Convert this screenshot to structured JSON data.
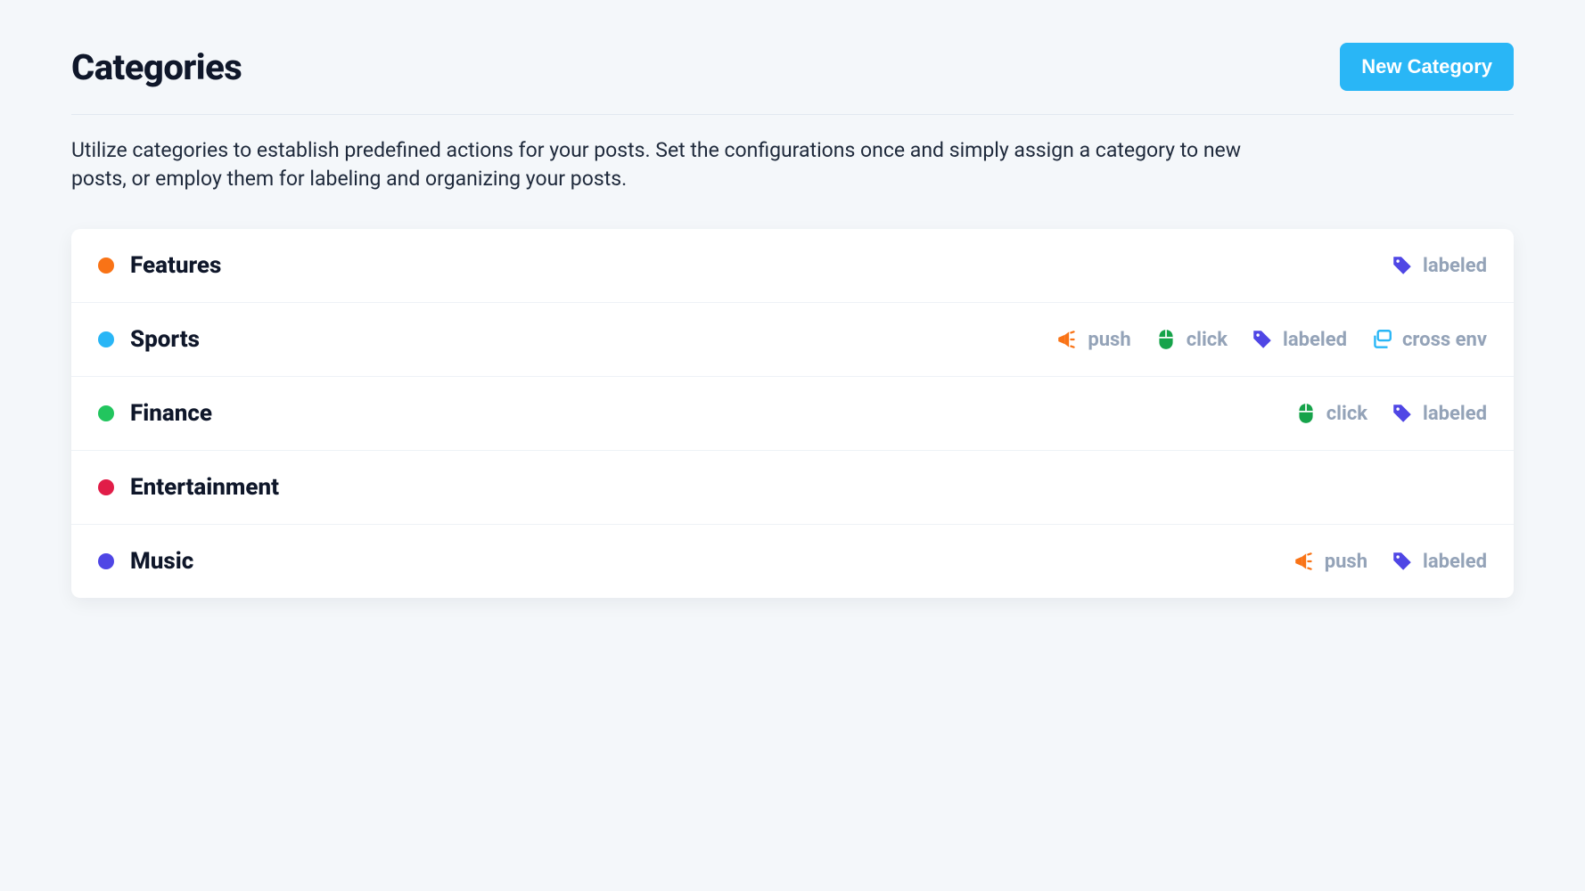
{
  "header": {
    "title": "Categories",
    "new_button": "New Category"
  },
  "description": "Utilize categories to establish predefined actions for your posts. Set the configurations once and simply assign a category to new posts, or employ them for labeling and organizing your posts.",
  "tag_types": {
    "push": {
      "label": "push",
      "icon": "bullhorn",
      "color": "#f97316"
    },
    "click": {
      "label": "click",
      "icon": "mouse",
      "color": "#16a34a"
    },
    "labeled": {
      "label": "labeled",
      "icon": "tag",
      "color": "#4f46e5"
    },
    "cross": {
      "label": "cross env",
      "icon": "layers",
      "color": "#29b6f6"
    }
  },
  "categories": [
    {
      "name": "Features",
      "color": "#f97316",
      "tags": [
        "labeled"
      ]
    },
    {
      "name": "Sports",
      "color": "#29b6f6",
      "tags": [
        "push",
        "click",
        "labeled",
        "cross"
      ]
    },
    {
      "name": "Finance",
      "color": "#22c55e",
      "tags": [
        "click",
        "labeled"
      ]
    },
    {
      "name": "Entertainment",
      "color": "#e11d48",
      "tags": []
    },
    {
      "name": "Music",
      "color": "#4f46e5",
      "tags": [
        "push",
        "labeled"
      ]
    }
  ]
}
